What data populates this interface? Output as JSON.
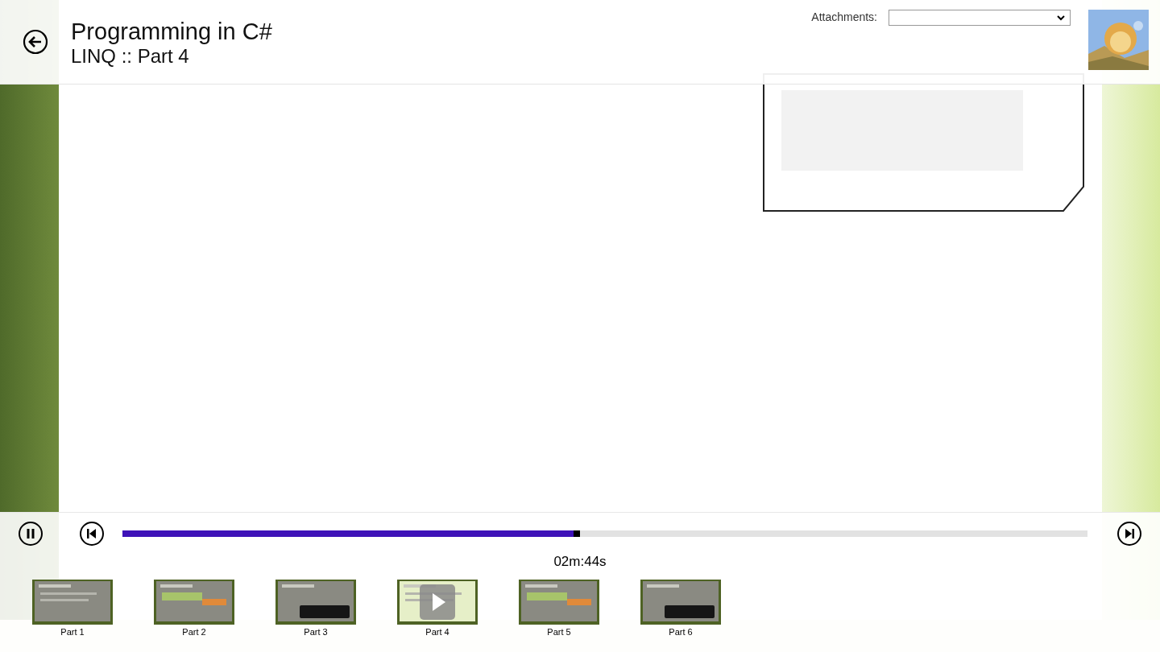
{
  "header": {
    "title": "Programming in C#",
    "subtitle": "LINQ :: Part 4",
    "attachments_label": "Attachments:"
  },
  "player": {
    "playing": true,
    "level": 0.474,
    "time": "02m:44s"
  },
  "parts": [
    {
      "label": "Part 1",
      "selected": false
    },
    {
      "label": "Part 2",
      "selected": false
    },
    {
      "label": "Part 3",
      "selected": false
    },
    {
      "label": "Part 4",
      "selected": true
    },
    {
      "label": "Part 5",
      "selected": false
    },
    {
      "label": "Part 6",
      "selected": false
    }
  ]
}
